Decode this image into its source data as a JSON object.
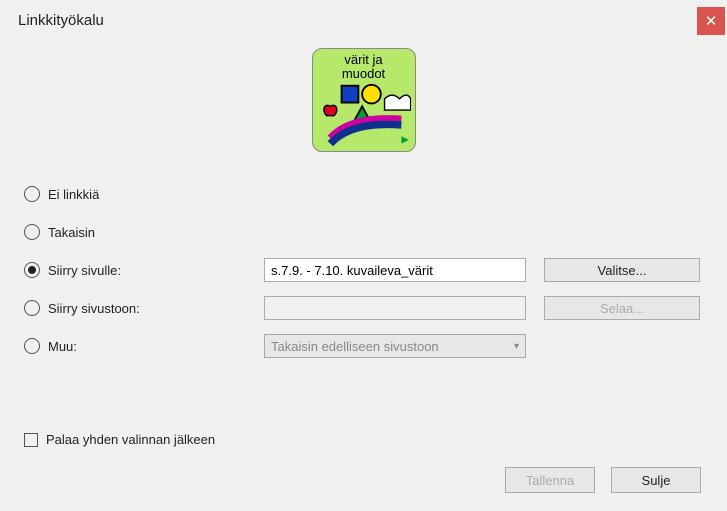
{
  "title": "Linkkityökalu",
  "thumb": {
    "line1": "värit ja",
    "line2": "muodot"
  },
  "options": {
    "none": {
      "label": "Ei linkkiä",
      "checked": false
    },
    "back": {
      "label": "Takaisin",
      "checked": false
    },
    "page": {
      "label": "Siirry sivulle:",
      "checked": true,
      "value": "s.7.9. - 7.10. kuvaileva_värit",
      "button": "Valitse..."
    },
    "site": {
      "label": "Siirry sivustoon:",
      "checked": false,
      "value": "",
      "button": "Selaa..."
    },
    "other": {
      "label": "Muu:",
      "checked": false,
      "selected": "Takaisin edelliseen sivustoon"
    }
  },
  "return_after": {
    "label": "Palaa yhden valinnan jälkeen",
    "checked": false
  },
  "footer": {
    "save": "Tallenna",
    "close": "Sulje"
  }
}
